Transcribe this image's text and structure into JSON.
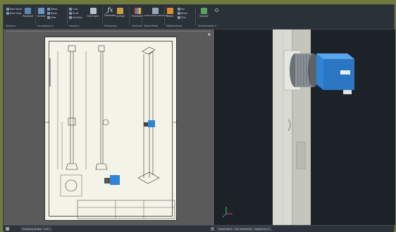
{
  "ribbon": {
    "groups": [
      {
        "label": "Sheets ▾",
        "items": [
          "New Sheet",
          "Base View"
        ]
      },
      {
        "label": "Annotations ▾",
        "items": [
          "Detail",
          "Section",
          "Break Out",
          "Slice",
          "Crop"
        ]
      },
      {
        "label": "Format ▾",
        "items": [
          "Edit Layer",
          "Style Editor",
          "Edit Styles"
        ]
      },
      {
        "label": "Dimension",
        "items": [
          "Dimension",
          "Text",
          "Leader"
        ]
      },
      {
        "label": "Symbols",
        "items": [
          "Parameter",
          "Symbol"
        ]
      },
      {
        "label": "Sheet Metal",
        "items": [
          "Create Section Definitions"
        ]
      },
      {
        "label": "Modifications",
        "items": [
          "Repair",
          "Arc",
          "Break",
          "Trim"
        ]
      },
      {
        "label": "Simplification ▾",
        "items": [
          "Simplify"
        ]
      }
    ],
    "buttons": {
      "new_sheet": "New Sheet",
      "base_view": "Base View",
      "projected": "Projected",
      "auxiliary": "Auxiliary",
      "section": "Section",
      "detail": "Detail",
      "break": "Break",
      "slice": "Slice",
      "crop": "Crop",
      "draft": "Draft",
      "edit_layer": "Edit Layer",
      "parameter": "Parameter",
      "symbol": "Symbol",
      "create_section": "Create Section Definitions",
      "repair": "Repair",
      "simplify": "Simplify"
    }
  },
  "status": {
    "tab_left": "Drawing Sheet: 1 of 1",
    "tab_right": "Assembly1 : Full Assembly - Sequence  ✕"
  },
  "colors": {
    "ribbon_bg": "#2b3138",
    "sheet_bg": "#f4f3e8",
    "viewport_bg": "#1c2228",
    "motor_blue": "#2f84d6"
  }
}
